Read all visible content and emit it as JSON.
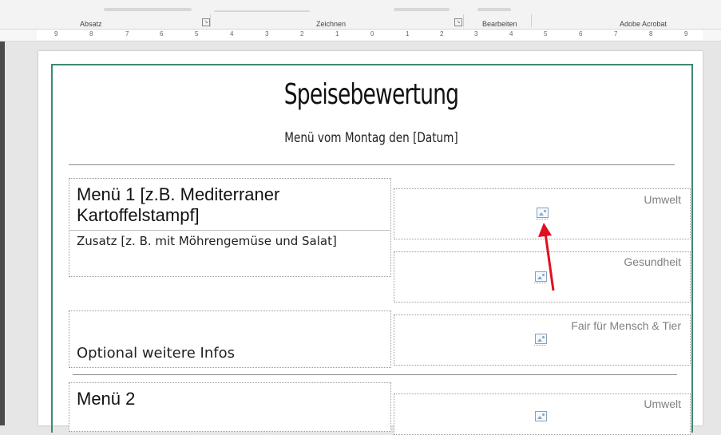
{
  "ribbon": {
    "groups": [
      "Absatz",
      "Zeichnen",
      "Bearbeiten",
      "Adobe Acrobat"
    ]
  },
  "ruler": {
    "marks": [
      "9",
      "8",
      "7",
      "6",
      "5",
      "4",
      "3",
      "2",
      "1",
      "0",
      "1",
      "2",
      "3",
      "4",
      "5",
      "6",
      "7",
      "8",
      "9"
    ]
  },
  "document": {
    "title": "Speisebewertung",
    "subtitle": "Menü vom Montag den [Datum]",
    "menu1": {
      "title": "Menü 1 [z.B. Mediterraner Kartoffelstampf]",
      "extra": "Zusatz [z. B. mit Möhrengemüse und Salat]",
      "more": "Optional weitere Infos"
    },
    "menu2": {
      "title": "Menü 2"
    },
    "ratings": [
      "Umwelt",
      "Gesundheit",
      "Fair für Mensch & Tier",
      "Umwelt"
    ]
  },
  "colors": {
    "frame": "#3d8a6a",
    "arrow": "#e01020"
  }
}
